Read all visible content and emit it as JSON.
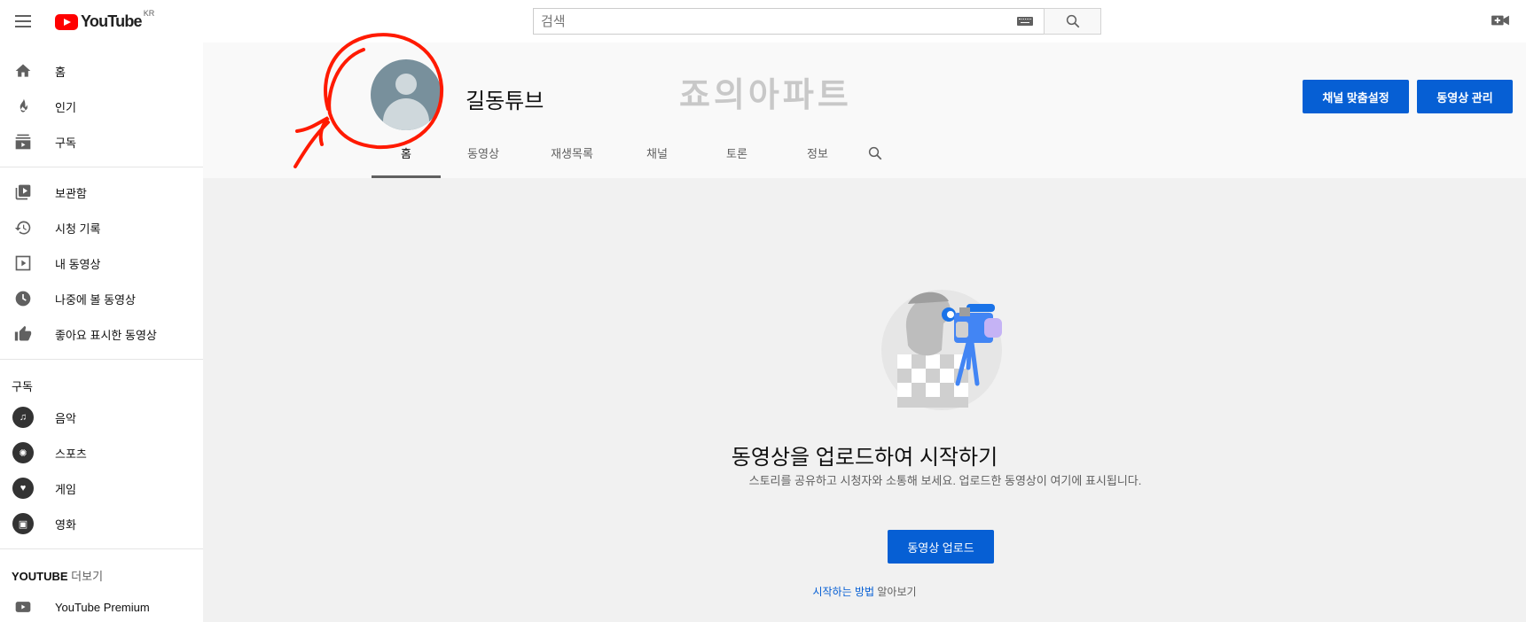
{
  "header": {
    "logo_text": "YouTube",
    "logo_region": "KR",
    "search_placeholder": "검색"
  },
  "sidebar": {
    "primary": [
      {
        "label": "홈",
        "icon": "home-icon"
      },
      {
        "label": "인기",
        "icon": "flame-icon"
      },
      {
        "label": "구독",
        "icon": "subscriptions-icon"
      }
    ],
    "library": [
      {
        "label": "보관함",
        "icon": "library-icon"
      },
      {
        "label": "시청 기록",
        "icon": "history-icon"
      },
      {
        "label": "내 동영상",
        "icon": "my-videos-icon"
      },
      {
        "label": "나중에 볼 동영상",
        "icon": "watch-later-icon"
      },
      {
        "label": "좋아요 표시한 동영상",
        "icon": "thumbs-up-icon"
      }
    ],
    "subs_heading": "구독",
    "subscriptions": [
      {
        "label": "음악",
        "icon": "music-icon"
      },
      {
        "label": "스포츠",
        "icon": "sports-icon"
      },
      {
        "label": "게임",
        "icon": "gaming-icon"
      },
      {
        "label": "영화",
        "icon": "movies-icon"
      }
    ],
    "more_heading_bold": "YOUTUBE",
    "more_heading_rest": " 더보기",
    "more": [
      {
        "label": "YouTube Premium",
        "icon": "youtube-premium-icon"
      }
    ]
  },
  "channel": {
    "name": "길동튜브",
    "watermark": "죠의아파트",
    "customize_label": "채널 맞춤설정",
    "manage_label": "동영상 관리",
    "tabs": [
      "홈",
      "동영상",
      "재생목록",
      "채널",
      "토론",
      "정보"
    ],
    "active_tab": "홈"
  },
  "empty_state": {
    "title": "동영상을 업로드하여 시작하기",
    "description": "스토리를 공유하고 시청자와 소통해 보세요. 업로드한 동영상이 여기에 표시됩니다.",
    "upload_label": "동영상 업로드",
    "learn_link": "시작하는 방법",
    "learn_rest": " 알아보기"
  },
  "colors": {
    "brand_red": "#ff0000",
    "accent_blue": "#065fd4",
    "scribble_red": "#ff1a00"
  }
}
